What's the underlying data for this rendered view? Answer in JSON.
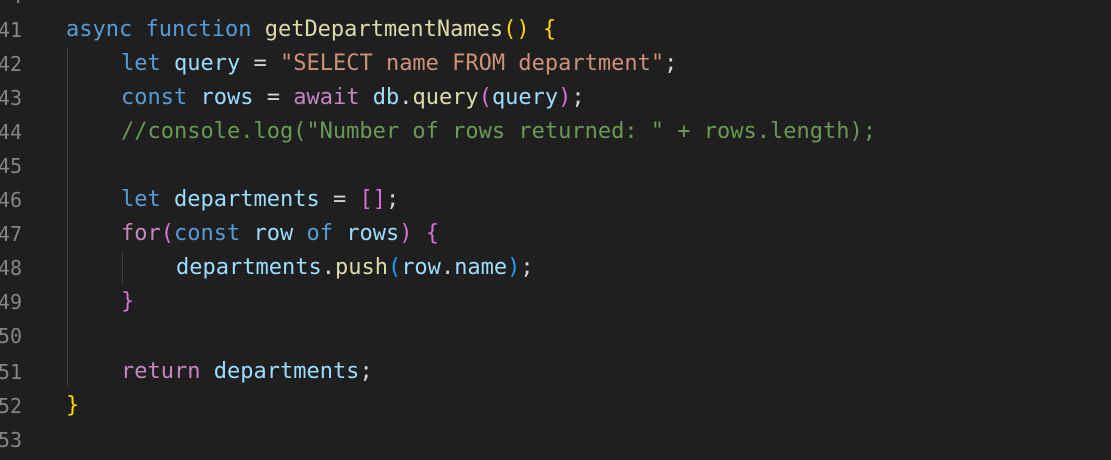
{
  "line_numbers": [
    "41",
    "42",
    "43",
    "44",
    "45",
    "46",
    "47",
    "48",
    "49",
    "50",
    "51",
    "52",
    "53"
  ],
  "code": {
    "l41": {
      "async": "async",
      "function": "function",
      "name": "getDepartmentNames",
      "parens": "()",
      "brace": "{"
    },
    "l42": {
      "let": "let",
      "var": "query",
      "eq": " = ",
      "str": "\"SELECT name FROM department\"",
      "semi": ";"
    },
    "l43": {
      "const": "const",
      "var": "rows",
      "eq": " = ",
      "await": "await",
      "obj": "db",
      "dot": ".",
      "method": "query",
      "lp": "(",
      "arg": "query",
      "rp": ")",
      "semi": ";"
    },
    "l44": {
      "comment": "//console.log(\"Number of rows returned: \" + rows.length);"
    },
    "l46": {
      "let": "let",
      "var": "departments",
      "eq": " = ",
      "arr": "[]",
      "semi": ";"
    },
    "l47": {
      "for": "for",
      "lp": "(",
      "const": "const",
      "item": "row",
      "of": "of",
      "iter": "rows",
      "rp": ")",
      "brace": "{"
    },
    "l48": {
      "obj": "departments",
      "dot": ".",
      "method": "push",
      "lp": "(",
      "arg_obj": "row",
      "dot2": ".",
      "arg_prop": "name",
      "rp": ")",
      "semi": ";"
    },
    "l49": {
      "brace": "}"
    },
    "l51": {
      "return": "return",
      "var": "departments",
      "semi": ";"
    },
    "l52": {
      "brace": "}"
    }
  },
  "colors": {
    "background": "#1f1f1f",
    "keyword": "#569cd6",
    "control": "#c586c0",
    "function": "#dcdcaa",
    "variable": "#9cdcfe",
    "string": "#ce9178",
    "comment": "#6a9955",
    "bracket_level1": "#ffd700",
    "bracket_level2": "#da70d6",
    "bracket_level3": "#179fff"
  }
}
